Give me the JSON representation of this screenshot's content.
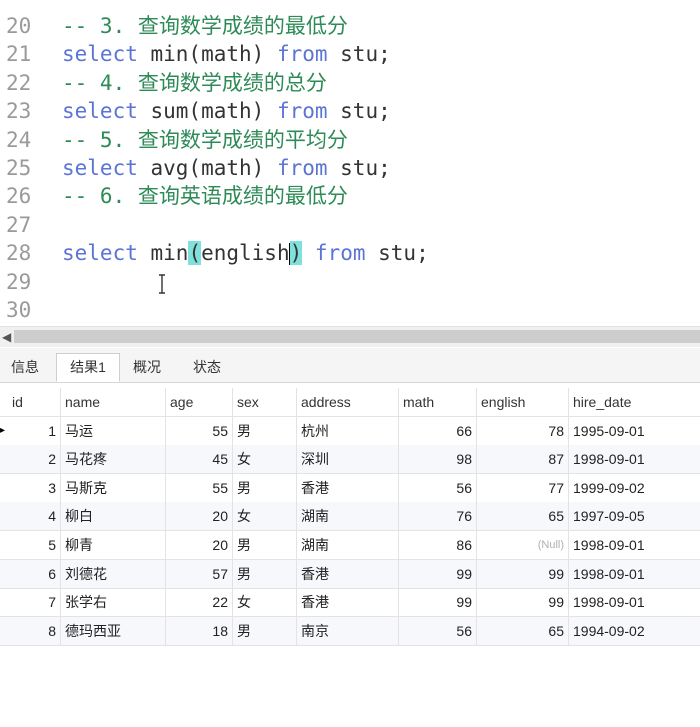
{
  "editor": {
    "lines": [
      {
        "num": "20",
        "kind": "comment",
        "text": "-- 3. 查询数学成绩的最低分"
      },
      {
        "num": "21",
        "kind": "sql",
        "kw1": "select",
        "expr": " min(math) ",
        "kw2": "from",
        "rest": " stu;"
      },
      {
        "num": "22",
        "kind": "comment",
        "text": "-- 4. 查询数学成绩的总分"
      },
      {
        "num": "23",
        "kind": "sql",
        "kw1": "select",
        "expr": " sum(math) ",
        "kw2": "from",
        "rest": " stu;"
      },
      {
        "num": "24",
        "kind": "comment",
        "text": "-- 5. 查询数学成绩的平均分"
      },
      {
        "num": "25",
        "kind": "sql",
        "kw1": "select",
        "expr": " avg(math) ",
        "kw2": "from",
        "rest": " stu;"
      },
      {
        "num": "26",
        "kind": "comment",
        "text": "-- 6. 查询英语成绩的最低分"
      },
      {
        "num": "27",
        "kind": "empty"
      },
      {
        "num": "28",
        "kind": "active",
        "kw1": "select",
        "fn": " min",
        "open": "(",
        "arg": "english",
        "close": ")",
        "kw2": "from",
        "rest": " stu;"
      },
      {
        "num": "29",
        "kind": "empty"
      },
      {
        "num": "30",
        "kind": "empty"
      }
    ]
  },
  "tabs": [
    "信息",
    "结果1",
    "概况",
    "状态"
  ],
  "active_tab": "结果1",
  "grid": {
    "columns": [
      "id",
      "name",
      "age",
      "sex",
      "address",
      "math",
      "english",
      "hire_date"
    ],
    "rows": [
      [
        "1",
        "马运",
        "55",
        "男",
        "杭州",
        "66",
        "78",
        "1995-09-01"
      ],
      [
        "2",
        "马花疼",
        "45",
        "女",
        "深圳",
        "98",
        "87",
        "1998-09-01"
      ],
      [
        "3",
        "马斯克",
        "55",
        "男",
        "香港",
        "56",
        "77",
        "1999-09-02"
      ],
      [
        "4",
        "柳白",
        "20",
        "女",
        "湖南",
        "76",
        "65",
        "1997-09-05"
      ],
      [
        "5",
        "柳青",
        "20",
        "男",
        "湖南",
        "86",
        "(Null)",
        "1998-09-01"
      ],
      [
        "6",
        "刘德花",
        "57",
        "男",
        "香港",
        "99",
        "99",
        "1998-09-01"
      ],
      [
        "7",
        "张学右",
        "22",
        "女",
        "香港",
        "99",
        "99",
        "1998-09-01"
      ],
      [
        "8",
        "德玛西亚",
        "18",
        "男",
        "南京",
        "56",
        "65",
        "1994-09-02"
      ]
    ],
    "row_marker": "▸"
  },
  "colors": {
    "keyword": "#5b74d6",
    "comment": "#2e8b57",
    "paren_highlight": "#7fe0dc",
    "line_number": "#9a9a9a"
  }
}
